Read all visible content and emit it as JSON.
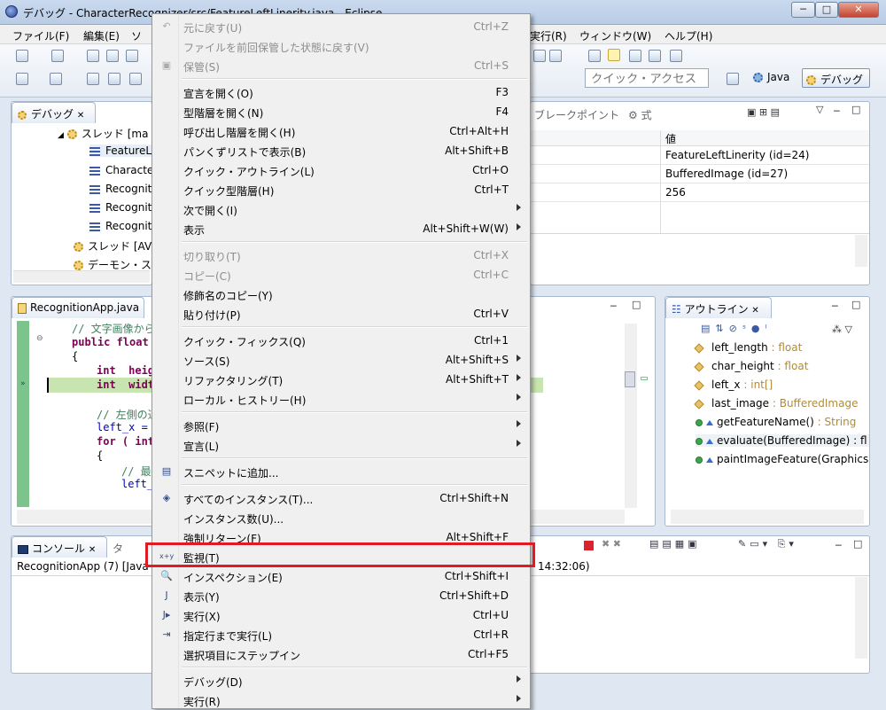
{
  "window": {
    "title": "デバッグ - CharacterRecognizer/src/FeatureLeftLinerity.java - Eclipse",
    "buttons": [
      "─",
      "□",
      "✕"
    ]
  },
  "menubar": [
    "ファイル(F)",
    "編集(E)",
    "ソ",
    "実行(R)",
    "ウィンドウ(W)",
    "ヘルプ(H)"
  ],
  "toolbar": {
    "quick_access_placeholder": "クイック・アクセス",
    "perspective_java": "Java",
    "perspective_debug": "デバッグ"
  },
  "debug_view": {
    "tab_label": "デバッグ",
    "tree": [
      {
        "label": "スレッド [ma",
        "kind": "thread"
      },
      {
        "label": "FeatureL",
        "kind": "frame"
      },
      {
        "label": "Characte",
        "kind": "frame"
      },
      {
        "label": "Recognit",
        "kind": "frame"
      },
      {
        "label": "Recognit",
        "kind": "frame"
      },
      {
        "label": "Recognit",
        "kind": "frame"
      },
      {
        "label": "スレッド [AV",
        "kind": "thread"
      },
      {
        "label": "デーモン・ス",
        "kind": "thread"
      }
    ]
  },
  "variables_view": {
    "tabs": [
      "ブレークポイント",
      "式"
    ],
    "col_value": "値",
    "values": [
      "FeatureLeftLinerity  (id=24)",
      "BufferedImage  (id=27)",
      "256",
      ""
    ]
  },
  "editor": {
    "tab_label": "RecognitionApp.java",
    "lines": [
      "// 文字画像から",
      "public float",
      "{",
      "int  heig",
      "int  widt",
      "",
      "// 左側の辺",
      "left_x =",
      "for ( int",
      "{",
      "// 最後",
      "left_"
    ]
  },
  "outline": {
    "tab_label": "アウトライン",
    "fields": [
      {
        "name": "left_length",
        "type": ": float"
      },
      {
        "name": "char_height",
        "type": ": float"
      },
      {
        "name": "left_x",
        "type": ": int[]"
      },
      {
        "name": "last_image",
        "type": ": BufferedImage"
      }
    ],
    "methods": [
      {
        "name": "getFeatureName()",
        "type": ": String"
      },
      {
        "name": "evaluate(BufferedImage)",
        "type": ": fl"
      },
      {
        "name": "paintImageFeature(Graphics",
        "type": ""
      }
    ]
  },
  "console": {
    "tab_label": "コンソール",
    "tab2_label": "タ",
    "line_left": "RecognitionApp (7) [Java",
    "line_right": "14:32:06)"
  },
  "context_menu": {
    "items": [
      {
        "label": "元に戻す(U)",
        "accel": "Ctrl+Z",
        "disabled": true,
        "icon": "undo-icon"
      },
      {
        "label": "ファイルを前回保管した状態に戻す(V)",
        "accel": "",
        "disabled": true
      },
      {
        "label": "保管(S)",
        "accel": "Ctrl+S",
        "disabled": true,
        "icon": "save-icon"
      },
      {
        "sep": true
      },
      {
        "label": "宣言を開く(O)",
        "accel": "F3"
      },
      {
        "label": "型階層を開く(N)",
        "accel": "F4"
      },
      {
        "label": "呼び出し階層を開く(H)",
        "accel": "Ctrl+Alt+H"
      },
      {
        "label": "パンくずリストで表示(B)",
        "accel": "Alt+Shift+B"
      },
      {
        "label": "クイック・アウトライン(L)",
        "accel": "Ctrl+O"
      },
      {
        "label": "クイック型階層(H)",
        "accel": "Ctrl+T"
      },
      {
        "label": "次で開く(I)",
        "accel": "",
        "submenu": true
      },
      {
        "label": "表示",
        "accel": "Alt+Shift+W(W)",
        "submenu": true
      },
      {
        "sep": true
      },
      {
        "label": "切り取り(T)",
        "accel": "Ctrl+X",
        "disabled": true
      },
      {
        "label": "コピー(C)",
        "accel": "Ctrl+C",
        "disabled": true
      },
      {
        "label": "修飾名のコピー(Y)",
        "accel": ""
      },
      {
        "label": "貼り付け(P)",
        "accel": "Ctrl+V"
      },
      {
        "sep": true
      },
      {
        "label": "クイック・フィックス(Q)",
        "accel": "Ctrl+1"
      },
      {
        "label": "ソース(S)",
        "accel": "Alt+Shift+S",
        "submenu": true
      },
      {
        "label": "リファクタリング(T)",
        "accel": "Alt+Shift+T",
        "submenu": true
      },
      {
        "label": "ローカル・ヒストリー(H)",
        "accel": "",
        "submenu": true
      },
      {
        "sep": true
      },
      {
        "label": "参照(F)",
        "accel": "",
        "submenu": true
      },
      {
        "label": "宣言(L)",
        "accel": "",
        "submenu": true
      },
      {
        "sep": true
      },
      {
        "label": "スニペットに追加...",
        "accel": "",
        "icon": "snippet-icon"
      },
      {
        "sep": true
      },
      {
        "label": "すべてのインスタンス(T)...",
        "accel": "Ctrl+Shift+N",
        "icon": "instances-icon"
      },
      {
        "label": "インスタンス数(U)...",
        "accel": ""
      },
      {
        "label": "強制リターン(F)",
        "accel": "Alt+Shift+F"
      },
      {
        "label": "監視(T)",
        "accel": "",
        "icon": "watch-icon",
        "highlighted": true
      },
      {
        "label": "インスペクション(E)",
        "accel": "Ctrl+Shift+I",
        "icon": "inspect-icon"
      },
      {
        "label": "表示(Y)",
        "accel": "Ctrl+Shift+D",
        "icon": "display-icon"
      },
      {
        "label": "実行(X)",
        "accel": "Ctrl+U",
        "icon": "execute-icon"
      },
      {
        "label": "指定行まで実行(L)",
        "accel": "Ctrl+R",
        "icon": "run-to-line-icon"
      },
      {
        "label": "選択項目にステップイン",
        "accel": "Ctrl+F5"
      },
      {
        "sep": true
      },
      {
        "label": "デバッグ(D)",
        "accel": "",
        "submenu": true
      },
      {
        "label": "実行(R)",
        "accel": "",
        "submenu": true
      }
    ]
  },
  "colors": {
    "highlight_box": "#e01b24",
    "keyword": "#7f0055",
    "comment": "#3f7f5f",
    "current_line": "#c8e4b0"
  }
}
